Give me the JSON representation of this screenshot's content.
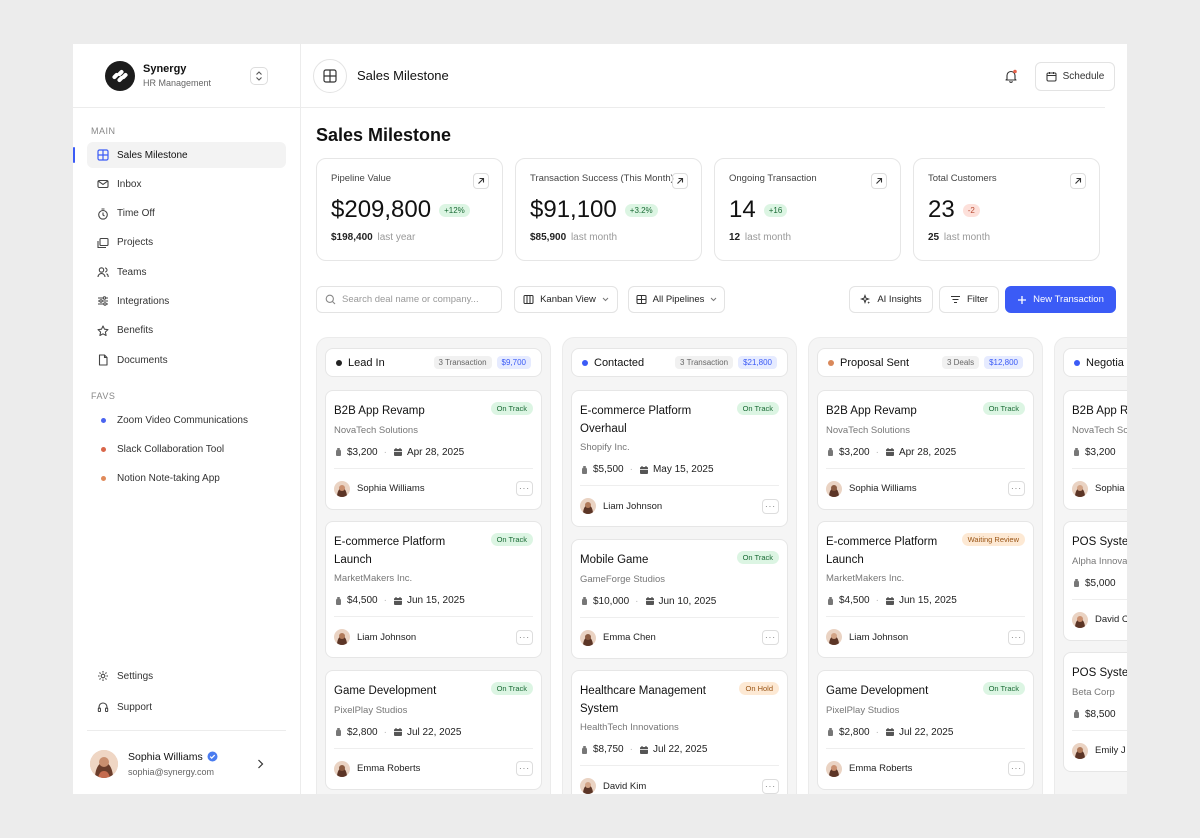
{
  "brand": {
    "name": "Synergy",
    "subtitle": "HR Management"
  },
  "sidebar": {
    "main_label": "MAIN",
    "items": [
      {
        "label": "Sales Milestone",
        "icon": "grid-icon",
        "active": true
      },
      {
        "label": "Inbox",
        "icon": "mail-icon"
      },
      {
        "label": "Time Off",
        "icon": "timer-icon"
      },
      {
        "label": "Projects",
        "icon": "folders-icon"
      },
      {
        "label": "Teams",
        "icon": "users-icon"
      },
      {
        "label": "Integrations",
        "icon": "sliders-icon"
      },
      {
        "label": "Benefits",
        "icon": "star-icon"
      },
      {
        "label": "Documents",
        "icon": "document-icon"
      }
    ],
    "favs_label": "FAVS",
    "favs": [
      {
        "label": "Zoom Video Communications",
        "color": "#4a64f0"
      },
      {
        "label": "Slack Collaboration Tool",
        "color": "#d9664a"
      },
      {
        "label": "Notion Note-taking App",
        "color": "#e08a5a"
      }
    ],
    "bottom": [
      {
        "label": "Settings",
        "icon": "gear-icon"
      },
      {
        "label": "Support",
        "icon": "headset-icon"
      }
    ],
    "profile": {
      "name": "Sophia Williams",
      "email": "sophia@synergy.com"
    }
  },
  "header": {
    "title": "Sales Milestone",
    "schedule_label": "Schedule"
  },
  "page": {
    "title": "Sales Milestone"
  },
  "stats": [
    {
      "label": "Pipeline Value",
      "value": "$209,800",
      "badge": "+12%",
      "sub_value": "$198,400",
      "sub_label": "last year"
    },
    {
      "label": "Transaction Success (This Month)",
      "value": "$91,100",
      "badge": "+3.2%",
      "sub_value": "$85,900",
      "sub_label": "last month"
    },
    {
      "label": "Ongoing Transaction",
      "value": "14",
      "badge": "+16",
      "sub_value": "12",
      "sub_label": "last month"
    },
    {
      "label": "Total Customers",
      "value": "23",
      "badge": "-2",
      "sub_value": "25",
      "sub_label": "last month"
    }
  ],
  "toolbar": {
    "search_placeholder": "Search deal name or company...",
    "view_label": "Kanban View",
    "pipelines_label": "All Pipelines",
    "ai_label": "AI Insights",
    "filter_label": "Filter",
    "new_label": "New Transaction"
  },
  "columns": [
    {
      "title": "Lead In",
      "dot": "#222222",
      "count": "3 Transaction",
      "amount": "$9,700",
      "cards": [
        {
          "title": "B2B App Revamp",
          "tag": "On Track",
          "company": "NovaTech Solutions",
          "amount": "$3,200",
          "date": "Apr 28, 2025",
          "person": "Sophia Williams"
        },
        {
          "title": "E-commerce Platform Launch",
          "tag": "On Track",
          "company": "MarketMakers Inc.",
          "amount": "$4,500",
          "date": "Jun 15, 2025",
          "person": "Liam Johnson"
        },
        {
          "title": "Game Development",
          "tag": "On Track",
          "company": "PixelPlay Studios",
          "amount": "$2,800",
          "date": "Jul 22, 2025",
          "person": "Emma Roberts"
        }
      ]
    },
    {
      "title": "Contacted",
      "dot": "#3b5bf6",
      "count": "3 Transaction",
      "amount": "$21,800",
      "cards": [
        {
          "title": "E-commerce Platform Overhaul",
          "tag": "On Track",
          "company": "Shopify Inc.",
          "amount": "$5,500",
          "date": "May 15, 2025",
          "person": "Liam Johnson"
        },
        {
          "title": "Mobile Game",
          "tag": "On Track",
          "company": "GameForge Studios",
          "amount": "$10,000",
          "date": "Jun 10, 2025",
          "person": "Emma Chen"
        },
        {
          "title": "Healthcare Management System",
          "tag": "On Hold",
          "company": "HealthTech Innovations",
          "amount": "$8,750",
          "date": "Jul 22, 2025",
          "person": "David Kim"
        }
      ]
    },
    {
      "title": "Proposal Sent",
      "dot": "#d9885a",
      "count": "3 Deals",
      "amount": "$12,800",
      "cards": [
        {
          "title": "B2B App Revamp",
          "tag": "On Track",
          "company": "NovaTech Solutions",
          "amount": "$3,200",
          "date": "Apr 28, 2025",
          "person": "Sophia Williams"
        },
        {
          "title": "E-commerce Platform Launch",
          "tag": "Waiting Review",
          "company": "MarketMakers Inc.",
          "amount": "$4,500",
          "date": "Jun 15, 2025",
          "person": "Liam Johnson"
        },
        {
          "title": "Game Development",
          "tag": "On Track",
          "company": "PixelPlay Studios",
          "amount": "$2,800",
          "date": "Jul 22, 2025",
          "person": "Emma Roberts"
        }
      ]
    },
    {
      "title": "Negotia",
      "dot": "#3b5bf6",
      "count": "",
      "amount": "",
      "cards": [
        {
          "title": "B2B App R",
          "tag": "",
          "company": "NovaTech So",
          "amount": "$3,200",
          "date": "",
          "person": "Sophia"
        },
        {
          "title": "POS Syste",
          "tag": "",
          "company": "Alpha Innova",
          "amount": "$5,000",
          "date": "",
          "person": "David C"
        },
        {
          "title": "POS Syste",
          "tag": "",
          "company": "Beta Corp",
          "amount": "$8,500",
          "date": "",
          "person": "Emily J"
        }
      ]
    }
  ]
}
